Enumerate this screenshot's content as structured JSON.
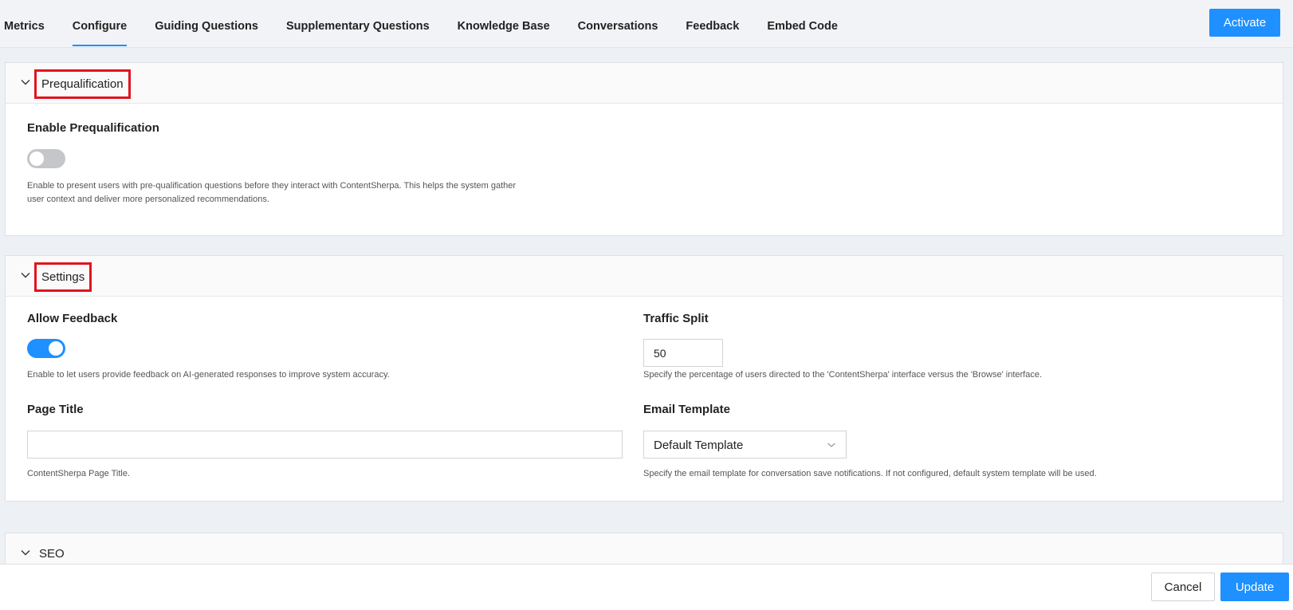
{
  "nav": {
    "tabs": [
      {
        "label": "Metrics"
      },
      {
        "label": "Configure"
      },
      {
        "label": "Guiding Questions"
      },
      {
        "label": "Supplementary Questions"
      },
      {
        "label": "Knowledge Base"
      },
      {
        "label": "Conversations"
      },
      {
        "label": "Feedback"
      },
      {
        "label": "Embed Code"
      }
    ],
    "active_tab": "Configure",
    "activate_label": "Activate"
  },
  "prequalification": {
    "title": "Prequalification",
    "enable_label": "Enable Prequalification",
    "enabled": false,
    "help_line1": "Enable to present users with pre-qualification questions before they interact with ContentSherpa. This helps the system gather",
    "help_line2": "user context and deliver more personalized recommendations."
  },
  "settings": {
    "title": "Settings",
    "allow_feedback": {
      "label": "Allow Feedback",
      "enabled": true,
      "help": "Enable to let users provide feedback on AI-generated responses to improve system accuracy."
    },
    "traffic_split": {
      "label": "Traffic Split",
      "value": "50",
      "help": "Specify the percentage of users directed to the 'ContentSherpa' interface versus the 'Browse' interface."
    },
    "page_title": {
      "label": "Page Title",
      "value": "",
      "help": "ContentSherpa Page Title."
    },
    "email_template": {
      "label": "Email Template",
      "selected": "Default Template",
      "help": "Specify the email template for conversation save notifications. If not configured, default system template will be used."
    }
  },
  "seo": {
    "title": "SEO"
  },
  "footer": {
    "cancel_label": "Cancel",
    "update_label": "Update"
  },
  "colors": {
    "accent": "#1e90ff",
    "highlight_border": "#e0141e",
    "toggle_off": "#c4c6c9"
  }
}
